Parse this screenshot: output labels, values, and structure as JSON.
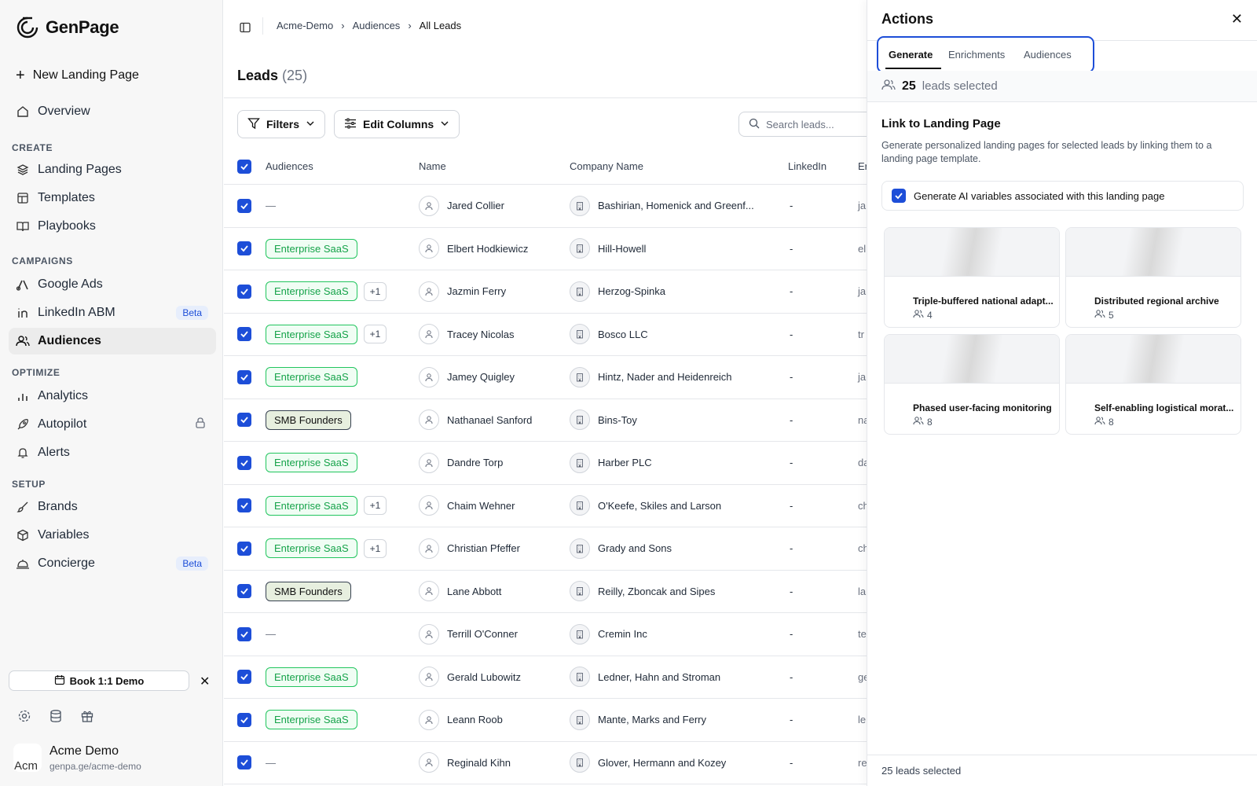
{
  "brand": {
    "name": "GenPage"
  },
  "sidebar": {
    "new_page": "New Landing Page",
    "overview": "Overview",
    "sections": {
      "create": "CREATE",
      "campaigns": "CAMPAIGNS",
      "optimize": "OPTIMIZE",
      "setup": "SETUP"
    },
    "items": {
      "landing_pages": "Landing Pages",
      "templates": "Templates",
      "playbooks": "Playbooks",
      "google_ads": "Google Ads",
      "linkedin_abm": "LinkedIn ABM",
      "audiences": "Audiences",
      "analytics": "Analytics",
      "autopilot": "Autopilot",
      "alerts": "Alerts",
      "brands": "Brands",
      "variables": "Variables",
      "concierge": "Concierge"
    },
    "beta": "Beta",
    "demo_button": "Book 1:1 Demo",
    "account": {
      "name": "Acme Demo",
      "url": "genpa.ge/acme-demo",
      "avatar_text": "Acm"
    }
  },
  "breadcrumb": [
    "Acme-Demo",
    "Audiences",
    "All Leads"
  ],
  "page": {
    "title": "Leads",
    "count": "(25)"
  },
  "toolbar": {
    "filters": "Filters",
    "edit_columns": "Edit Columns",
    "search_placeholder": "Search leads..."
  },
  "table": {
    "headers": {
      "audiences": "Audiences",
      "name": "Name",
      "company": "Company Name",
      "linkedin": "LinkedIn",
      "email": "Er"
    },
    "rows": [
      {
        "tag": "",
        "plus": "",
        "name": "Jared Collier",
        "company": "Bashirian, Homenick and Greenf...",
        "linkedin": "-",
        "email": "ja"
      },
      {
        "tag": "Enterprise SaaS",
        "plus": "",
        "name": "Elbert Hodkiewicz",
        "company": "Hill-Howell",
        "linkedin": "-",
        "email": "el"
      },
      {
        "tag": "Enterprise SaaS",
        "plus": "+1",
        "name": "Jazmin Ferry",
        "company": "Herzog-Spinka",
        "linkedin": "-",
        "email": "ja"
      },
      {
        "tag": "Enterprise SaaS",
        "plus": "+1",
        "name": "Tracey Nicolas",
        "company": "Bosco LLC",
        "linkedin": "-",
        "email": "tr"
      },
      {
        "tag": "Enterprise SaaS",
        "plus": "",
        "name": "Jamey Quigley",
        "company": "Hintz, Nader and Heidenreich",
        "linkedin": "-",
        "email": "ja"
      },
      {
        "tag": "SMB Founders",
        "plus": "",
        "name": "Nathanael Sanford",
        "company": "Bins-Toy",
        "linkedin": "-",
        "email": "na"
      },
      {
        "tag": "Enterprise SaaS",
        "plus": "",
        "name": "Dandre Torp",
        "company": "Harber PLC",
        "linkedin": "-",
        "email": "da"
      },
      {
        "tag": "Enterprise SaaS",
        "plus": "+1",
        "name": "Chaim Wehner",
        "company": "O'Keefe, Skiles and Larson",
        "linkedin": "-",
        "email": "ch"
      },
      {
        "tag": "Enterprise SaaS",
        "plus": "+1",
        "name": "Christian Pfeffer",
        "company": "Grady and Sons",
        "linkedin": "-",
        "email": "ch"
      },
      {
        "tag": "SMB Founders",
        "plus": "",
        "name": "Lane Abbott",
        "company": "Reilly, Zboncak and Sipes",
        "linkedin": "-",
        "email": "la"
      },
      {
        "tag": "",
        "plus": "",
        "name": "Terrill O'Conner",
        "company": "Cremin Inc",
        "linkedin": "-",
        "email": "te"
      },
      {
        "tag": "Enterprise SaaS",
        "plus": "",
        "name": "Gerald Lubowitz",
        "company": "Ledner, Hahn and Stroman",
        "linkedin": "-",
        "email": "ge"
      },
      {
        "tag": "Enterprise SaaS",
        "plus": "",
        "name": "Leann Roob",
        "company": "Mante, Marks and Ferry",
        "linkedin": "-",
        "email": "le"
      },
      {
        "tag": "",
        "plus": "",
        "name": "Reginald Kihn",
        "company": "Glover, Hermann and Kozey",
        "linkedin": "-",
        "email": "re"
      }
    ]
  },
  "actions": {
    "title": "Actions",
    "tabs": [
      "Generate",
      "Enrichments",
      "Audiences"
    ],
    "selected_count": "25",
    "selected_suffix": "leads selected",
    "link_heading": "Link to Landing Page",
    "link_desc": "Generate personalized landing pages for selected leads by linking them to a landing page template.",
    "ai_checkbox_label": "Generate AI variables associated with this landing page",
    "templates": [
      {
        "title": "Triple-buffered national adapt...",
        "count": "4"
      },
      {
        "title": "Distributed regional archive",
        "count": "5"
      },
      {
        "title": "Phased user-facing monitoring",
        "count": "8"
      },
      {
        "title": "Self-enabling logistical morat...",
        "count": "8"
      }
    ],
    "footer": "25 leads selected"
  },
  "colors": {
    "accent": "#1d4ed8",
    "tag_green": "#16a34a",
    "tag_smb_bg": "#e7efdf"
  }
}
